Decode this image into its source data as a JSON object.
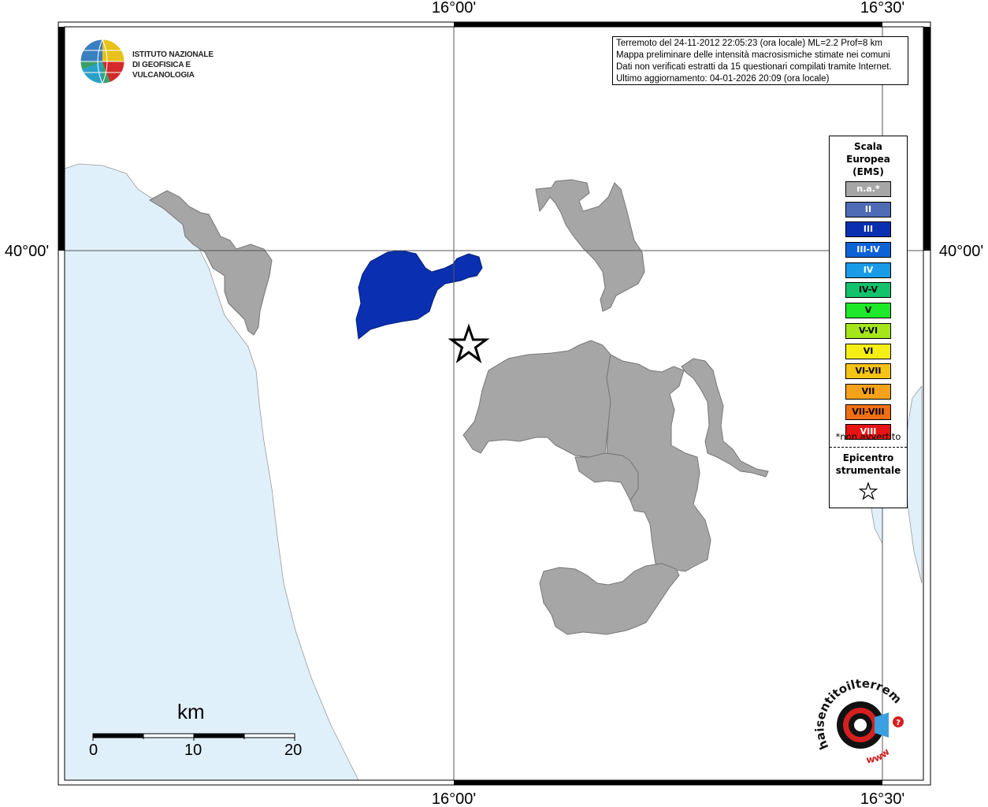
{
  "axes": {
    "top": [
      "16°00'",
      "16°30'"
    ],
    "bottom": [
      "16°00'",
      "16°30'"
    ],
    "left": [
      "40°00'"
    ],
    "right": [
      "40°00'"
    ]
  },
  "logo": {
    "line1": "ISTITUTO NAZIONALE",
    "line2": "DI GEOFISICA E VULCANOLOGIA"
  },
  "info": {
    "line1": "Terremoto del 24-11-2012 22:05:23 (ora locale) ML=2.2 Prof=8 km",
    "line2": "Mappa preliminare delle intensità macrosismiche stimate nei comuni",
    "line3": "Dati non verificati estratti da 15 questionari compilati tramite Internet.",
    "line4": "Ultimo aggiornamento: 04-01-2026 20:09 (ora locale)"
  },
  "legend": {
    "title_line1": "Scala",
    "title_line2": "Europea",
    "title_line3": "(EMS)",
    "items": [
      {
        "label": "n.a.*",
        "color": "#a6a6a6",
        "text_color": "#ffffff"
      },
      {
        "label": "II",
        "color": "#4f6bb5",
        "text_color": "#ffffff"
      },
      {
        "label": "III",
        "color": "#0a2fb0",
        "text_color": "#ffffff"
      },
      {
        "label": "III-IV",
        "color": "#0d63d6",
        "text_color": "#ffffff"
      },
      {
        "label": "IV",
        "color": "#1a9be8",
        "text_color": "#ffffff"
      },
      {
        "label": "IV-V",
        "color": "#13c26b",
        "text_color": "#000000"
      },
      {
        "label": "V",
        "color": "#1ee82a",
        "text_color": "#000000"
      },
      {
        "label": "V-VI",
        "color": "#a5e61a",
        "text_color": "#000000"
      },
      {
        "label": "VI",
        "color": "#f5ee14",
        "text_color": "#000000"
      },
      {
        "label": "VI-VII",
        "color": "#f5c316",
        "text_color": "#000000"
      },
      {
        "label": "VII",
        "color": "#f5a21a",
        "text_color": "#000000"
      },
      {
        "label": "VII-VIII",
        "color": "#f06f14",
        "text_color": "#000000"
      },
      {
        "label": "VIII",
        "color": "#e81414",
        "text_color": "#ffffff"
      }
    ],
    "note": "*non avvertito",
    "epicenter_line1": "Epicentro",
    "epicenter_line2": "strumentale"
  },
  "scale": {
    "unit": "km",
    "ticks": [
      "0",
      "10",
      "20"
    ]
  },
  "colors": {
    "sea": "#e0f0fb",
    "municipality_na": "#a6a6a6",
    "municipality_iii": "#0a2fb0"
  },
  "hst_logo": {
    "text": "haisentitoilterremoto.it",
    "www": "www"
  }
}
